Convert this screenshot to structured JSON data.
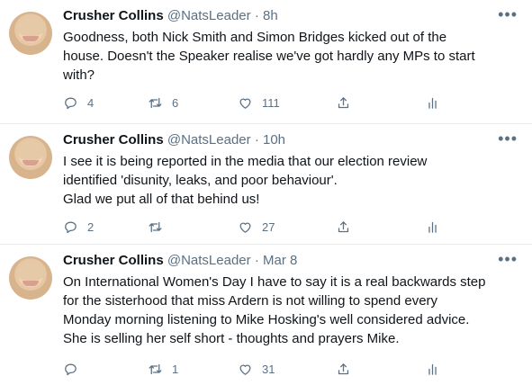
{
  "tweets": [
    {
      "name": "Crusher Collins",
      "handle": "@NatsLeader",
      "dot": "·",
      "time": "8h",
      "text": "Goodness, both Nick Smith and Simon Bridges kicked out of the\nhouse. Doesn't the Speaker realise we've got hardly any MPs to start\nwith?",
      "replies": "4",
      "retweets": "6",
      "likes": "111"
    },
    {
      "name": "Crusher Collins",
      "handle": "@NatsLeader",
      "dot": "·",
      "time": "10h",
      "text": "I see it is being reported in the media that our election review\nidentified 'disunity, leaks, and poor behaviour'.\nGlad we put all of that behind us!",
      "replies": "2",
      "retweets": "",
      "likes": "27"
    },
    {
      "name": "Crusher Collins",
      "handle": "@NatsLeader",
      "dot": "·",
      "time": "Mar 8",
      "text": "On International Women's Day I have to say it is a real backwards step\nfor the sisterhood that miss Ardern is not willing to spend every\nMonday morning listening to Mike Hosking's well considered advice.\nShe is selling her self short - thoughts and prayers Mike.",
      "replies": "",
      "retweets": "1",
      "likes": "31"
    }
  ],
  "more_glyph": "•••",
  "icons": {
    "reply": "reply-icon",
    "retweet": "retweet-icon",
    "like": "heart-icon",
    "share": "share-icon",
    "stats": "analytics-icon",
    "more": "more-options-icon"
  },
  "colors": {
    "text": "#0f1419",
    "secondary": "#5b7083",
    "divider": "#e6ecf0"
  }
}
